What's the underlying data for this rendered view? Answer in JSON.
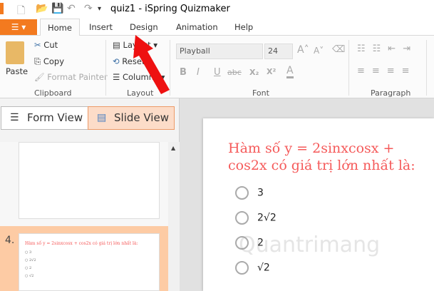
{
  "window": {
    "title": "quiz1 - iSpring Quizmaker"
  },
  "tabs": [
    "Home",
    "Insert",
    "Design",
    "Animation",
    "Help"
  ],
  "ribbon": {
    "clipboard": {
      "paste": "Paste",
      "cut": "Cut",
      "copy": "Copy",
      "format_painter": "Format Painter",
      "label": "Clipboard"
    },
    "layout": {
      "layout": "Layout",
      "reset": "Reset",
      "columns": "Columns",
      "label": "Layout"
    },
    "font": {
      "font_name": "Playball",
      "font_size": "24",
      "bold": "B",
      "italic": "I",
      "underline": "U",
      "strike": "abc",
      "sub": "X₂",
      "sup": "X²",
      "color": "A",
      "label": "Font"
    },
    "paragraph": {
      "label": "Paragraph"
    }
  },
  "views": {
    "form": "Form View",
    "slide": "Slide View"
  },
  "slides": [
    {
      "number": "4.",
      "question": "Hàm số y = 2sinxcosx + cos2x có giá trị lớn nhất là:",
      "options": [
        "3",
        "2√2",
        "2",
        "√2"
      ]
    }
  ],
  "editor": {
    "question": "Hàm số y = 2sinxcosx + cos2x có giá trị lớn nhất là:",
    "options": [
      "3",
      "2√2",
      "2",
      "√2"
    ]
  },
  "watermark": "Quantrimang",
  "colors": {
    "accent": "#f37a1f",
    "question": "#f55a5a",
    "selected": "#fdcba4"
  }
}
